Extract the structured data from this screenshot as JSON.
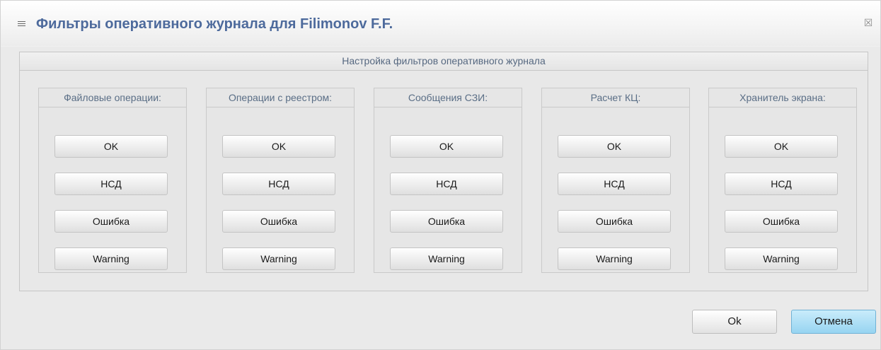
{
  "window": {
    "title": "Фильтры оперативного журнала для Filimonov F.F.",
    "close_symbol": "☒",
    "menu_icon": "menu-lines-icon"
  },
  "group": {
    "header": "Настройка фильтров оперативного журнала"
  },
  "panels": [
    {
      "title": "Файловые операции:",
      "buttons": [
        "OK",
        "НСД",
        "Ошибка",
        "Warning"
      ]
    },
    {
      "title": "Операции с реестром:",
      "buttons": [
        "OK",
        "НСД",
        "Ошибка",
        "Warning"
      ]
    },
    {
      "title": "Сообщения СЗИ:",
      "buttons": [
        "OK",
        "НСД",
        "Ошибка",
        "Warning"
      ]
    },
    {
      "title": "Расчет КЦ:",
      "buttons": [
        "OK",
        "НСД",
        "Ошибка",
        "Warning"
      ]
    },
    {
      "title": "Хранитель экрана:",
      "buttons": [
        "OK",
        "НСД",
        "Ошибка",
        "Warning"
      ]
    }
  ],
  "footer": {
    "ok_label": "Ok",
    "cancel_label": "Отмена"
  },
  "colors": {
    "title": "#4d6a9c",
    "cancel_accent": "#97d4f1"
  }
}
